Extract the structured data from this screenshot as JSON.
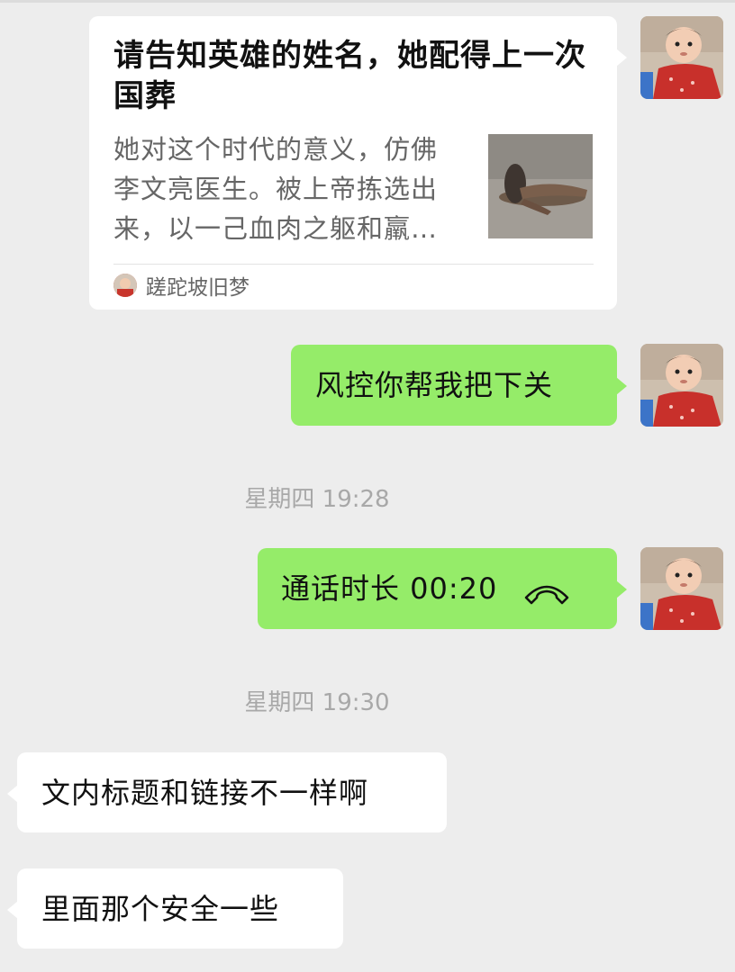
{
  "messages": {
    "card": {
      "title": "请告知英雄的姓名，她配得上一次国葬",
      "description": "她对这个时代的意义，仿佛李文亮医生。被上帝拣选出来，以一己血肉之躯和羸…",
      "source": "蹉跎坡旧梦",
      "thumbnail_icon": "photo-thumbnail"
    },
    "msg1": {
      "text": "风控你帮我把下关"
    },
    "time1": "星期四 19:28",
    "call": {
      "text": "通话时长 00:20",
      "icon": "phone-hangup-icon"
    },
    "time2": "星期四 19:30",
    "msg2": {
      "text": "文内标题和链接不一样啊"
    },
    "msg3": {
      "text": "里面那个安全一些"
    }
  },
  "colors": {
    "background": "#ededed",
    "bubble_green": "#95ec69",
    "bubble_white": "#ffffff",
    "timestamp": "#a8a8a8"
  }
}
